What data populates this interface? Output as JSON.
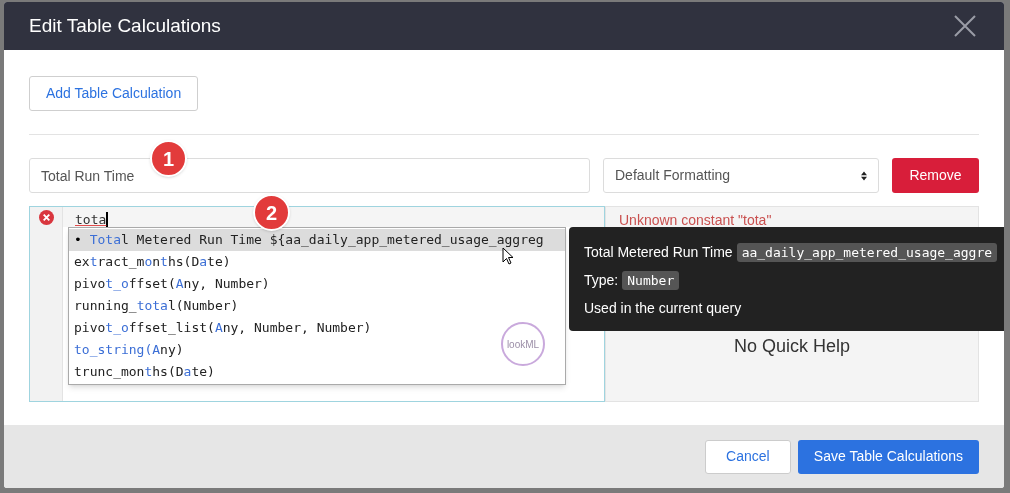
{
  "dialog": {
    "title": "Edit Table Calculations"
  },
  "add_button": "Add Table Calculation",
  "calculation": {
    "name": {
      "value": "Total Run Time"
    },
    "format": {
      "value": "Default Formatting"
    },
    "remove_button": "Remove",
    "expression": "tota",
    "has_error": true,
    "autocomplete": [
      {
        "selected": true,
        "bullet": "•",
        "parts": [
          {
            "text": "Tota",
            "match": true
          },
          {
            "text": "l Metered Run Time ${aa_daily_app_metered_usage_aggreg",
            "match": false
          }
        ]
      },
      {
        "selected": false,
        "parts": [
          {
            "text": "ex",
            "match": false
          },
          {
            "text": "t",
            "match": true
          },
          {
            "text": "ract_m",
            "match": false
          },
          {
            "text": "o",
            "match": true
          },
          {
            "text": "n",
            "match": false
          },
          {
            "text": "t",
            "match": true
          },
          {
            "text": "hs(D",
            "match": false
          },
          {
            "text": "a",
            "match": true
          },
          {
            "text": "te)",
            "match": false
          }
        ]
      },
      {
        "selected": false,
        "parts": [
          {
            "text": "pivo",
            "match": false
          },
          {
            "text": "t_o",
            "match": true
          },
          {
            "text": "ffset(",
            "match": false
          },
          {
            "text": "A",
            "match": true
          },
          {
            "text": "ny, Number)",
            "match": false
          }
        ]
      },
      {
        "selected": false,
        "parts": [
          {
            "text": "running_",
            "match": false
          },
          {
            "text": "tota",
            "match": true
          },
          {
            "text": "l(Number)",
            "match": false
          }
        ]
      },
      {
        "selected": false,
        "parts": [
          {
            "text": "pivo",
            "match": false
          },
          {
            "text": "t_o",
            "match": true
          },
          {
            "text": "ffset_list(",
            "match": false
          },
          {
            "text": "A",
            "match": true
          },
          {
            "text": "ny, Number, Number)",
            "match": false
          }
        ]
      },
      {
        "selected": false,
        "parts": [
          {
            "text": "to_string(",
            "match": true
          },
          {
            "text": "A",
            "match": true
          },
          {
            "text": "ny)",
            "match": false
          }
        ]
      },
      {
        "selected": false,
        "parts": [
          {
            "text": "trunc_mon",
            "match": false
          },
          {
            "text": "t",
            "match": true
          },
          {
            "text": "hs(D",
            "match": false
          },
          {
            "text": "a",
            "match": true
          },
          {
            "text": "te)",
            "match": false
          }
        ]
      }
    ],
    "logo_text": "lookML",
    "error_message": "Unknown constant \"tota\"",
    "quick_help": "No Quick Help",
    "tooltip": {
      "name": "Total Metered Run Time",
      "field": "aa_daily_app_metered_usage_aggre",
      "type_label": "Type:",
      "type": "Number",
      "note": "Used in the current query"
    }
  },
  "steps": [
    "1",
    "2"
  ],
  "footer": {
    "cancel": "Cancel",
    "save": "Save Table Calculations"
  }
}
